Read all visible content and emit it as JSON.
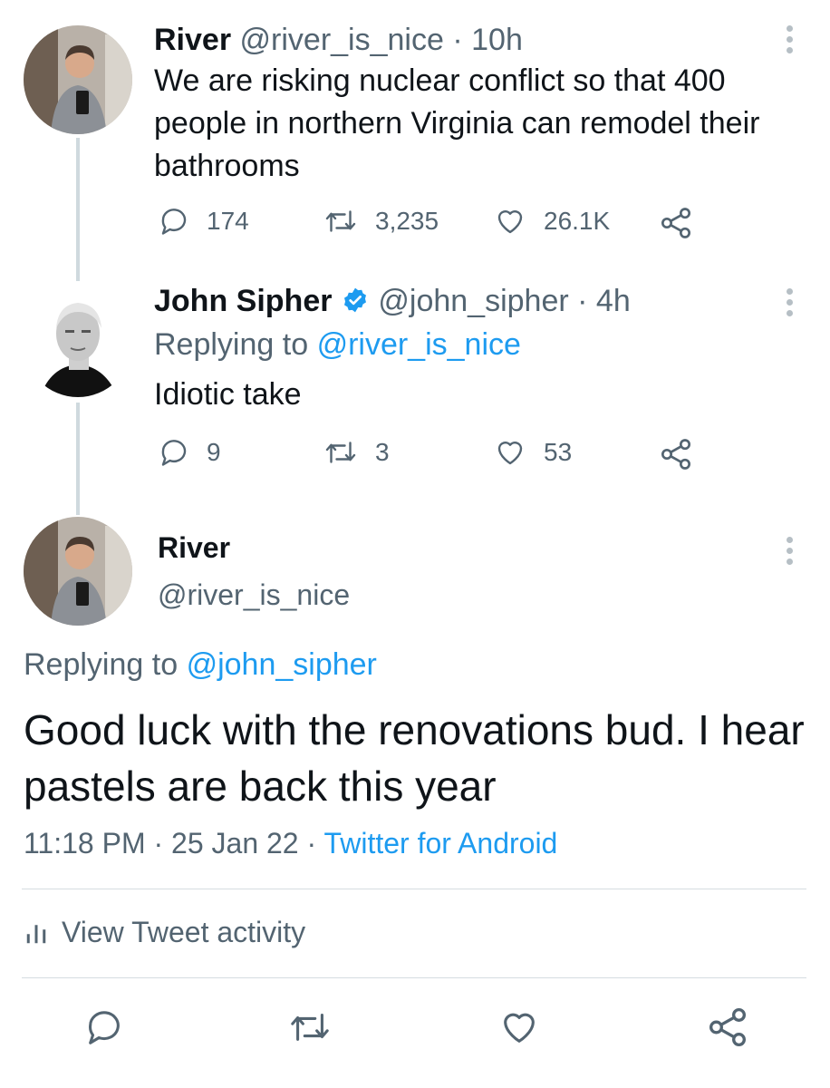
{
  "tweets": [
    {
      "name": "River",
      "handle": "@river_is_nice",
      "time": "10h",
      "text": "We are risking nuclear conflict so that 400 people in northern Virginia can remodel their bathrooms",
      "replies": "174",
      "retweets": "3,235",
      "likes": "26.1K"
    },
    {
      "name": "John Sipher",
      "handle": "@john_sipher",
      "time": "4h",
      "replying_prefix": "Replying to",
      "replying_to": "@river_is_nice",
      "text": "Idiotic take",
      "replies": "9",
      "retweets": "3",
      "likes": "53",
      "verified_icon": "verified-badge-icon"
    }
  ],
  "main_tweet": {
    "name": "River",
    "handle": "@river_is_nice",
    "replying_prefix": "Replying to",
    "replying_to": "@john_sipher",
    "text": "Good luck with the renovations bud. I hear pastels are back this year",
    "time": "11:18 PM",
    "date": "25 Jan 22",
    "source": "Twitter for Android",
    "activity_label": "View Tweet activity"
  },
  "colors": {
    "link": "#1d9bf0",
    "secondary_text": "#536471",
    "thread_line": "#cfd9de",
    "verified": "#1d9bf0"
  },
  "icons": [
    "reply-icon",
    "retweet-icon",
    "like-icon",
    "share-icon",
    "more-icon",
    "analytics-icon",
    "verified-badge-icon"
  ]
}
